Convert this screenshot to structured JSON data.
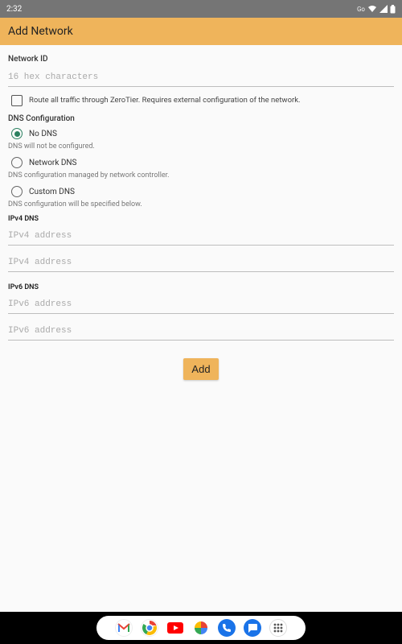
{
  "status_bar": {
    "time": "2:32",
    "badge": "Go"
  },
  "app_bar": {
    "title": "Add Network"
  },
  "network_id": {
    "label": "Network ID",
    "placeholder": "16 hex characters"
  },
  "route_all": {
    "label": "Route all traffic through ZeroTier. Requires external configuration of the network."
  },
  "dns": {
    "heading": "DNS Configuration",
    "options": [
      {
        "label": "No DNS",
        "hint": "DNS will not be configured."
      },
      {
        "label": "Network DNS",
        "hint": "DNS configuration managed by network controller."
      },
      {
        "label": "Custom DNS",
        "hint": "DNS configuration will be specified below."
      }
    ]
  },
  "ipv4": {
    "heading": "IPv4 DNS",
    "placeholder1": "IPv4 address",
    "placeholder2": "IPv4 address"
  },
  "ipv6": {
    "heading": "IPv6 DNS",
    "placeholder1": "IPv6 address",
    "placeholder2": "IPv6 address"
  },
  "add_button": "Add",
  "dock": {
    "gmail": "gmail-icon",
    "chrome": "chrome-icon",
    "youtube": "youtube-icon",
    "photos": "photos-icon",
    "phone": "phone-icon",
    "messages": "messages-icon",
    "apps": "apps-icon"
  }
}
